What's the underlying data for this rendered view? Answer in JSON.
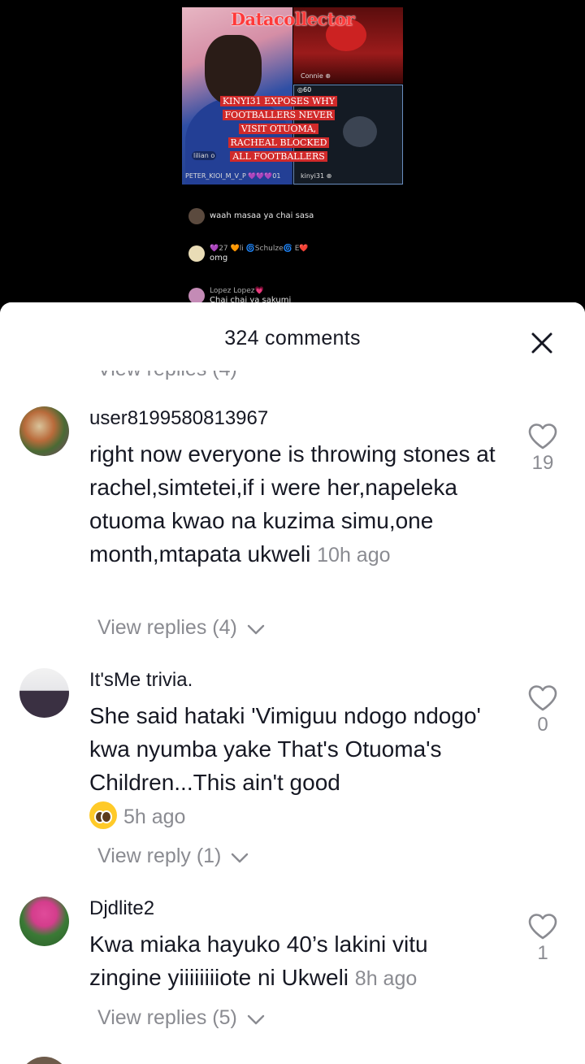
{
  "video": {
    "thumbnail_title": "Datacollector",
    "headline_lines": [
      "KINYI31 EXPOSES WHY",
      "FOOTBALLERS NEVER",
      "VISIT OTUOMA,",
      "RACHEAL BLOCKED",
      "ALL FOOTBALLERS"
    ],
    "tags": {
      "connie": "Connie ⊕",
      "count": "◎60",
      "lilian": "lilian o",
      "peter": "PETER_KIOI_M_V_P 💜💜💜01",
      "kinyi": "kinyi31 ⊕"
    },
    "live_comments": [
      {
        "name": "",
        "text": "waah masaa ya chai sasa"
      },
      {
        "name": "💜27 🧡li 🌀Schulze🌀  E❤️",
        "text": "omg"
      },
      {
        "name": "Lopez Lopez💗",
        "text": "Chai chai ya sakumi"
      }
    ]
  },
  "sheet": {
    "title": "324 comments",
    "close_icon": "close-icon",
    "cut_replies_label": "View replies (4)",
    "comments": [
      {
        "username": "user8199580813967",
        "text": "right now everyone is throwing stones at rachel,simtetei,if i were her,napeleka otuoma kwao na kuzima simu,one month,mtapata ukweli",
        "time": "10h ago",
        "likes": "19",
        "replies_label": "View replies (4)"
      },
      {
        "username": "It'sMe trivia.",
        "text": "She said hataki 'Vimiguu ndogo ndogo' kwa nyumba yake That's Otuoma's Children...This ain't good",
        "emoji": "pleading-face",
        "time": "5h ago",
        "likes": "0",
        "replies_label": "View reply (1)"
      },
      {
        "username": "Djdlite2",
        "text": "Kwa miaka hayuko 40’s lakini vitu zingine yiiiiiiiiote ni Ukweli",
        "time": "8h ago",
        "likes": "1",
        "replies_label": "View replies (5)"
      }
    ]
  }
}
